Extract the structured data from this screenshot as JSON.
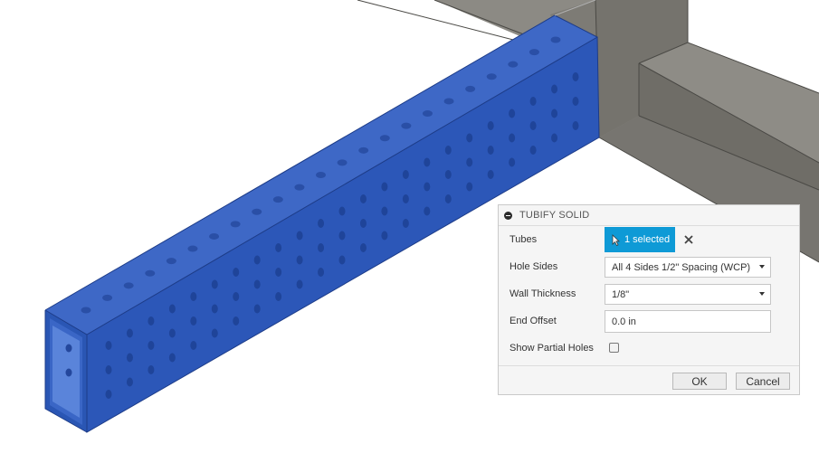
{
  "dialog": {
    "title": "TUBIFY SOLID",
    "tubes_label": "Tubes",
    "tubes_selection": "1 selected",
    "hole_sides_label": "Hole Sides",
    "hole_sides_value": "All 4 Sides 1/2\" Spacing (WCP)",
    "wall_thickness_label": "Wall Thickness",
    "wall_thickness_value": "1/8\"",
    "end_offset_label": "End Offset",
    "end_offset_value": "0.0 in",
    "show_partial_holes_label": "Show Partial Holes",
    "show_partial_holes_checked": false,
    "ok_label": "OK",
    "cancel_label": "Cancel"
  },
  "colors": {
    "tube_top": "#3e68c6",
    "tube_front": "#2c57b8",
    "tube_end": "#2a56b4",
    "frame_top": "#8d8b85",
    "frame_side": "#6b6963",
    "selection_accent": "#0e9ad6"
  },
  "icons": [
    "minus-icon",
    "cursor-icon",
    "close-icon",
    "dropdown-caret-icon"
  ]
}
